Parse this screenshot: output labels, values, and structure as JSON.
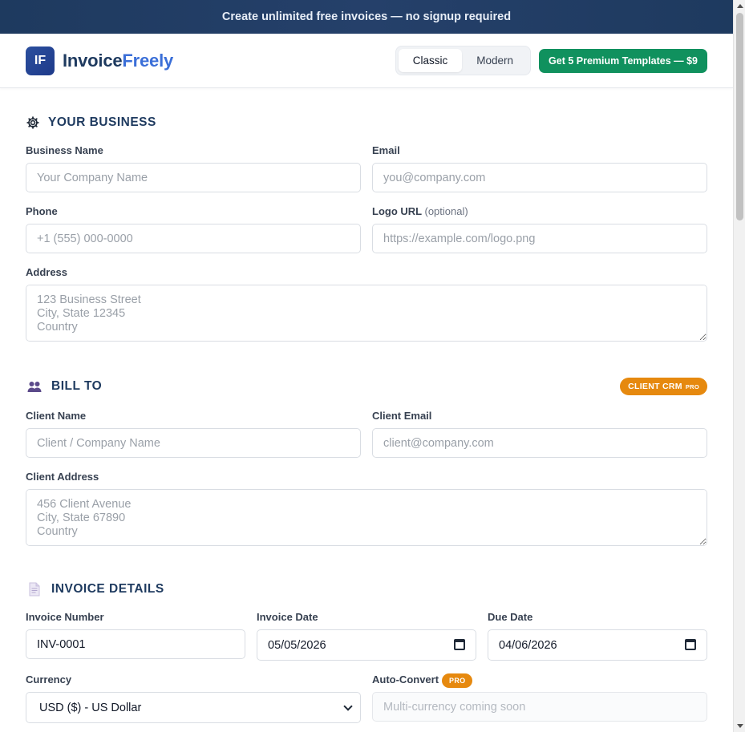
{
  "promo": {
    "text": "Create unlimited free invoices — no signup required"
  },
  "brand": {
    "logo_text": "IF",
    "name_part1": "Invoice",
    "name_part2": "Freely"
  },
  "template_toggle": {
    "options": [
      "Classic",
      "Modern"
    ],
    "selected": "Classic"
  },
  "premium_button": {
    "label": "Get 5 Premium Templates — $9"
  },
  "business": {
    "title": "YOUR BUSINESS",
    "icon": "gear-icon",
    "business_name": {
      "label": "Business Name",
      "placeholder": "Your Company Name",
      "value": ""
    },
    "email": {
      "label": "Email",
      "placeholder": "you@company.com",
      "value": ""
    },
    "phone": {
      "label": "Phone",
      "placeholder": "+1 (555) 000-0000",
      "value": ""
    },
    "logo_url": {
      "label": "Logo URL",
      "optional": "(optional)",
      "placeholder": "https://example.com/logo.png",
      "value": ""
    },
    "address": {
      "label": "Address",
      "placeholder": "123 Business Street\nCity, State 12345\nCountry",
      "value": ""
    }
  },
  "bill_to": {
    "title": "BILL TO",
    "icon": "people-icon",
    "badge": "CLIENT CRM",
    "badge_small": "PRO",
    "client_name": {
      "label": "Client Name",
      "placeholder": "Client / Company Name",
      "value": ""
    },
    "client_email": {
      "label": "Client Email",
      "placeholder": "client@company.com",
      "value": ""
    },
    "client_address": {
      "label": "Client Address",
      "placeholder": "456 Client Avenue\nCity, State 67890\nCountry",
      "value": ""
    }
  },
  "invoice_details": {
    "title": "INVOICE DETAILS",
    "icon": "document-icon",
    "invoice_number": {
      "label": "Invoice Number",
      "value": "INV-0001"
    },
    "invoice_date": {
      "label": "Invoice Date",
      "value": "05/05/2026"
    },
    "due_date": {
      "label": "Due Date",
      "value": "04/06/2026"
    },
    "currency": {
      "label": "Currency",
      "value": "USD ($) - US Dollar"
    },
    "auto_convert": {
      "label": "Auto-Convert",
      "badge": "PRO",
      "placeholder": "Multi-currency coming soon"
    }
  },
  "colors": {
    "promo_bg": "#1e3a5f",
    "brand_dark": "#1e3a5f",
    "brand_accent": "#3b6fd8",
    "premium_green": "#10915e",
    "pro_orange": "#e6890f"
  }
}
